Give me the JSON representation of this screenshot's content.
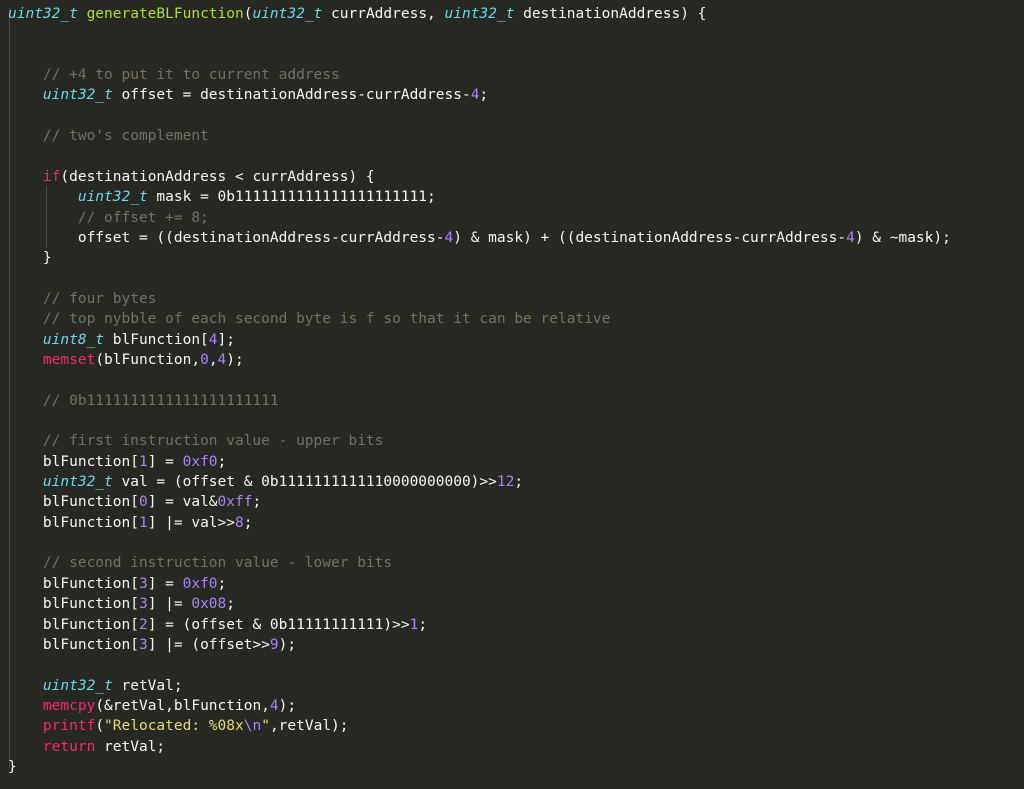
{
  "editor": {
    "lines": [
      {
        "tokens": [
          {
            "text": "uint32_t",
            "kind": "type"
          },
          {
            "text": " ",
            "kind": "tx"
          },
          {
            "text": "generateBLFunction",
            "kind": "fn"
          },
          {
            "text": "(",
            "kind": "tx"
          },
          {
            "text": "uint32_t",
            "kind": "type"
          },
          {
            "text": " currAddress, ",
            "kind": "tx"
          },
          {
            "text": "uint32_t",
            "kind": "type"
          },
          {
            "text": " destinationAddress) {",
            "kind": "tx"
          }
        ]
      },
      {
        "tokens": []
      },
      {
        "tokens": []
      },
      {
        "tokens": [
          {
            "text": "    // +4 to put it to current address",
            "kind": "cm"
          }
        ]
      },
      {
        "tokens": [
          {
            "text": "    ",
            "kind": "tx"
          },
          {
            "text": "uint32_t",
            "kind": "type"
          },
          {
            "text": " offset = destinationAddress-currAddress-",
            "kind": "tx"
          },
          {
            "text": "4",
            "kind": "num"
          },
          {
            "text": ";",
            "kind": "tx"
          }
        ]
      },
      {
        "tokens": []
      },
      {
        "tokens": [
          {
            "text": "    // two's complement",
            "kind": "cm"
          }
        ]
      },
      {
        "tokens": []
      },
      {
        "tokens": [
          {
            "text": "    ",
            "kind": "tx"
          },
          {
            "text": "if",
            "kind": "kw"
          },
          {
            "text": "(destinationAddress < currAddress) {",
            "kind": "tx"
          }
        ]
      },
      {
        "tokens": [
          {
            "text": "        ",
            "kind": "tx"
          },
          {
            "text": "uint32_t",
            "kind": "type"
          },
          {
            "text": " mask = 0b1111111111111111111111;",
            "kind": "tx"
          }
        ]
      },
      {
        "tokens": [
          {
            "text": "        // offset += 8;",
            "kind": "cm"
          }
        ]
      },
      {
        "tokens": [
          {
            "text": "        offset = ((destinationAddress-currAddress-",
            "kind": "tx"
          },
          {
            "text": "4",
            "kind": "num"
          },
          {
            "text": ") & mask) + ((destinationAddress-currAddress-",
            "kind": "tx"
          },
          {
            "text": "4",
            "kind": "num"
          },
          {
            "text": ") & ~mask);",
            "kind": "tx"
          }
        ]
      },
      {
        "tokens": [
          {
            "text": "    }",
            "kind": "tx"
          }
        ]
      },
      {
        "tokens": []
      },
      {
        "tokens": [
          {
            "text": "    // four bytes",
            "kind": "cm"
          }
        ]
      },
      {
        "tokens": [
          {
            "text": "    // top nybble of each second byte is f so that it can be relative",
            "kind": "cm"
          }
        ]
      },
      {
        "tokens": [
          {
            "text": "    ",
            "kind": "tx"
          },
          {
            "text": "uint8_t",
            "kind": "type"
          },
          {
            "text": " blFunction[",
            "kind": "tx"
          },
          {
            "text": "4",
            "kind": "num"
          },
          {
            "text": "];",
            "kind": "tx"
          }
        ]
      },
      {
        "tokens": [
          {
            "text": "    ",
            "kind": "tx"
          },
          {
            "text": "memset",
            "kind": "type-plain"
          },
          {
            "text": "(blFunction,",
            "kind": "tx"
          },
          {
            "text": "0",
            "kind": "num"
          },
          {
            "text": ",",
            "kind": "tx"
          },
          {
            "text": "4",
            "kind": "num"
          },
          {
            "text": ");",
            "kind": "tx"
          }
        ]
      },
      {
        "tokens": []
      },
      {
        "tokens": [
          {
            "text": "    // 0b1111111111111111111111",
            "kind": "cm"
          }
        ]
      },
      {
        "tokens": []
      },
      {
        "tokens": [
          {
            "text": "    // first instruction value - upper bits",
            "kind": "cm"
          }
        ]
      },
      {
        "tokens": [
          {
            "text": "    blFunction[",
            "kind": "tx"
          },
          {
            "text": "1",
            "kind": "num"
          },
          {
            "text": "] = ",
            "kind": "tx"
          },
          {
            "text": "0xf0",
            "kind": "num"
          },
          {
            "text": ";",
            "kind": "tx"
          }
        ]
      },
      {
        "tokens": [
          {
            "text": "    ",
            "kind": "tx"
          },
          {
            "text": "uint32_t",
            "kind": "type"
          },
          {
            "text": " val = (offset & 0b1111111111110000000000)>>",
            "kind": "tx"
          },
          {
            "text": "12",
            "kind": "num"
          },
          {
            "text": ";",
            "kind": "tx"
          }
        ]
      },
      {
        "tokens": [
          {
            "text": "    blFunction[",
            "kind": "tx"
          },
          {
            "text": "0",
            "kind": "num"
          },
          {
            "text": "] = val&",
            "kind": "tx"
          },
          {
            "text": "0xff",
            "kind": "num"
          },
          {
            "text": ";",
            "kind": "tx"
          }
        ]
      },
      {
        "tokens": [
          {
            "text": "    blFunction[",
            "kind": "tx"
          },
          {
            "text": "1",
            "kind": "num"
          },
          {
            "text": "] |= val>>",
            "kind": "tx"
          },
          {
            "text": "8",
            "kind": "num"
          },
          {
            "text": ";",
            "kind": "tx"
          }
        ]
      },
      {
        "tokens": []
      },
      {
        "tokens": [
          {
            "text": "    // second instruction value - lower bits",
            "kind": "cm"
          }
        ]
      },
      {
        "tokens": [
          {
            "text": "    blFunction[",
            "kind": "tx"
          },
          {
            "text": "3",
            "kind": "num"
          },
          {
            "text": "] = ",
            "kind": "tx"
          },
          {
            "text": "0xf0",
            "kind": "num"
          },
          {
            "text": ";",
            "kind": "tx"
          }
        ]
      },
      {
        "tokens": [
          {
            "text": "    blFunction[",
            "kind": "tx"
          },
          {
            "text": "3",
            "kind": "num"
          },
          {
            "text": "] |= ",
            "kind": "tx"
          },
          {
            "text": "0x08",
            "kind": "num"
          },
          {
            "text": ";",
            "kind": "tx"
          }
        ]
      },
      {
        "tokens": [
          {
            "text": "    blFunction[",
            "kind": "tx"
          },
          {
            "text": "2",
            "kind": "num"
          },
          {
            "text": "] = (offset & 0b11111111111)>>",
            "kind": "tx"
          },
          {
            "text": "1",
            "kind": "num"
          },
          {
            "text": ";",
            "kind": "tx"
          }
        ]
      },
      {
        "tokens": [
          {
            "text": "    blFunction[",
            "kind": "tx"
          },
          {
            "text": "3",
            "kind": "num"
          },
          {
            "text": "] |= (offset>>",
            "kind": "tx"
          },
          {
            "text": "9",
            "kind": "num"
          },
          {
            "text": ");",
            "kind": "tx"
          }
        ]
      },
      {
        "tokens": []
      },
      {
        "tokens": [
          {
            "text": "    ",
            "kind": "tx"
          },
          {
            "text": "uint32_t",
            "kind": "type"
          },
          {
            "text": " retVal;",
            "kind": "tx"
          }
        ]
      },
      {
        "tokens": [
          {
            "text": "    ",
            "kind": "tx"
          },
          {
            "text": "memcpy",
            "kind": "type-plain"
          },
          {
            "text": "(&retVal,blFunction,",
            "kind": "tx"
          },
          {
            "text": "4",
            "kind": "num"
          },
          {
            "text": ");",
            "kind": "tx"
          }
        ]
      },
      {
        "tokens": [
          {
            "text": "    ",
            "kind": "tx"
          },
          {
            "text": "printf",
            "kind": "type-plain"
          },
          {
            "text": "(",
            "kind": "tx"
          },
          {
            "text": "\"Relocated: %08x",
            "kind": "str"
          },
          {
            "text": "\\n",
            "kind": "esc"
          },
          {
            "text": "\"",
            "kind": "str"
          },
          {
            "text": ",retVal);",
            "kind": "tx"
          }
        ]
      },
      {
        "tokens": [
          {
            "text": "    ",
            "kind": "tx"
          },
          {
            "text": "return",
            "kind": "kw"
          },
          {
            "text": " retVal;",
            "kind": "tx"
          }
        ]
      },
      {
        "tokens": [
          {
            "text": "}",
            "kind": "tx"
          }
        ]
      }
    ]
  },
  "colors": {
    "background": "#272822",
    "text": "#f8f8f2",
    "keyword": "#f92672",
    "type": "#66d9ef",
    "function": "#a6e22e",
    "number": "#ae81ff",
    "string": "#e6db74",
    "comment": "#75715e"
  }
}
